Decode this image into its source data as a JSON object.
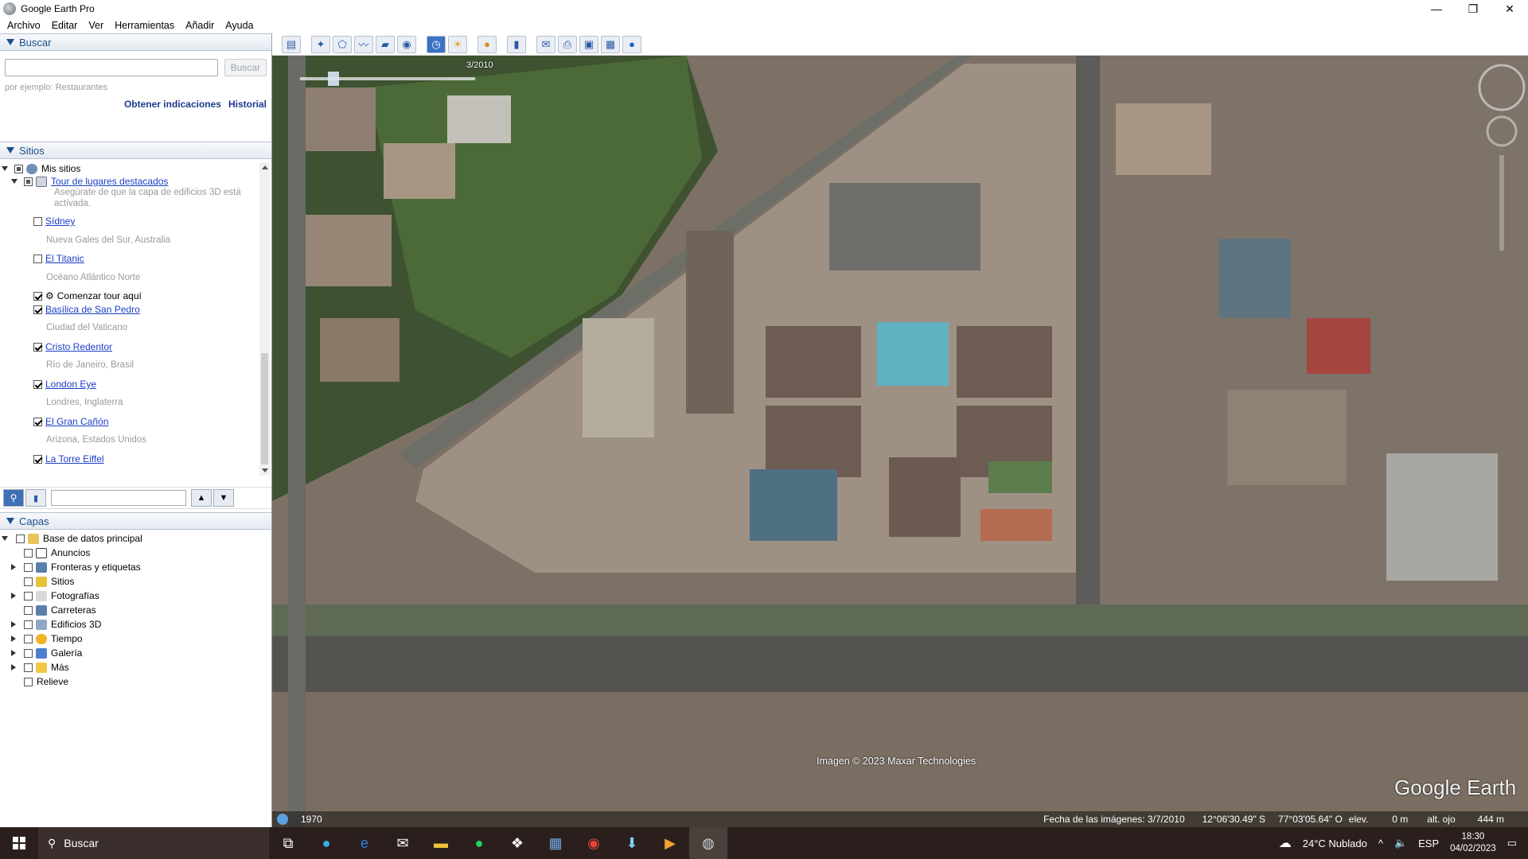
{
  "window": {
    "title": "Google Earth Pro",
    "minimize": "—",
    "maximize": "❐",
    "close": "✕"
  },
  "menu": [
    "Archivo",
    "Editar",
    "Ver",
    "Herramientas",
    "Añadir",
    "Ayuda"
  ],
  "search": {
    "header": "Buscar",
    "placeholder": "",
    "button": "Buscar",
    "hint": "por ejemplo: Restaurantes",
    "link_directions": "Obtener indicaciones",
    "link_history": "Historial"
  },
  "places": {
    "header": "Sitios",
    "my_places": "Mis sitios",
    "tour_folder": "Tour de lugares destacados",
    "tour_note_1": "Asegúrate de que la capa de edificios 3D está",
    "tour_note_2": "activada.",
    "items": [
      {
        "label": "Sídney",
        "sub": "Nueva Gales del Sur, Australia",
        "checked": false
      },
      {
        "label": "El Titanic",
        "sub": "Océano Atlántico Norte",
        "checked": false
      },
      {
        "label": "Comenzar tour aquí",
        "sub": "",
        "checked": true
      },
      {
        "label": "Basílica de San Pedro",
        "sub": "Ciudad del Vaticano",
        "checked": true
      },
      {
        "label": "Cristo Redentor",
        "sub": "Río de Janeiro, Brasil",
        "checked": true
      },
      {
        "label": "London Eye",
        "sub": "Londres, Inglaterra",
        "checked": true
      },
      {
        "label": "El Gran Cañón",
        "sub": "Arizona, Estados Unidos",
        "checked": true
      },
      {
        "label": "La Torre Eiffel",
        "sub": "",
        "checked": true
      }
    ]
  },
  "layers": {
    "header": "Capas",
    "root": "Base de datos principal",
    "items": [
      "Anuncios",
      "Fronteras y etiquetas",
      "Sitios",
      "Fotografías",
      "Carreteras",
      "Edificios 3D",
      "Tiempo",
      "Galería",
      "Más",
      "Relieve"
    ]
  },
  "map": {
    "time_slider_label": "3/2010",
    "year_start": "1970",
    "copyright": "Imagen © 2023 Maxar Technologies",
    "brand": "Google Earth",
    "status_date": "Fecha de las imágenes: 3/7/2010",
    "status_lat": "12°06'30.49\" S",
    "status_lon": "77°03'05.64\" O",
    "status_elev_label": "elev.",
    "status_elev": "0 m",
    "status_eye_label": "alt. ojo",
    "status_eye": "444 m"
  },
  "taskbar": {
    "search": "Buscar",
    "weather": "24°C  Nublado",
    "lang": "ESP",
    "time": "18:30",
    "date": "04/02/2023"
  },
  "colors": {
    "accent": "#1a4f8b",
    "link": "#1b3ec6",
    "taskbar": "#2a1f1c"
  }
}
